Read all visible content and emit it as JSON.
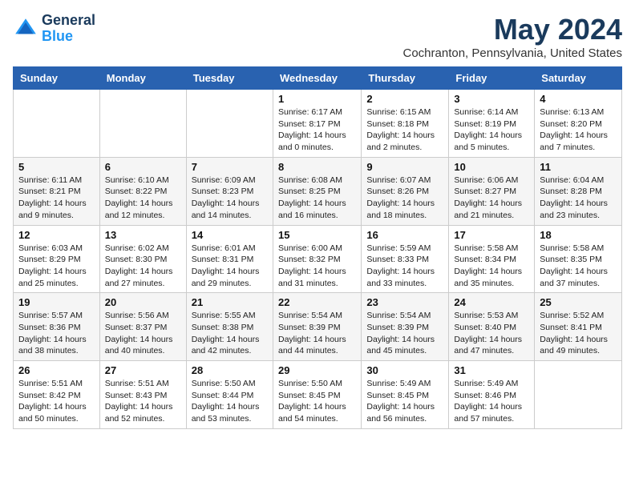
{
  "header": {
    "logo_line1": "General",
    "logo_line2": "Blue",
    "month": "May 2024",
    "location": "Cochranton, Pennsylvania, United States"
  },
  "weekdays": [
    "Sunday",
    "Monday",
    "Tuesday",
    "Wednesday",
    "Thursday",
    "Friday",
    "Saturday"
  ],
  "weeks": [
    [
      null,
      null,
      null,
      {
        "day": 1,
        "sunrise": "6:17 AM",
        "sunset": "8:17 PM",
        "daylight": "14 hours and 0 minutes."
      },
      {
        "day": 2,
        "sunrise": "6:15 AM",
        "sunset": "8:18 PM",
        "daylight": "14 hours and 2 minutes."
      },
      {
        "day": 3,
        "sunrise": "6:14 AM",
        "sunset": "8:19 PM",
        "daylight": "14 hours and 5 minutes."
      },
      {
        "day": 4,
        "sunrise": "6:13 AM",
        "sunset": "8:20 PM",
        "daylight": "14 hours and 7 minutes."
      }
    ],
    [
      {
        "day": 5,
        "sunrise": "6:11 AM",
        "sunset": "8:21 PM",
        "daylight": "14 hours and 9 minutes."
      },
      {
        "day": 6,
        "sunrise": "6:10 AM",
        "sunset": "8:22 PM",
        "daylight": "14 hours and 12 minutes."
      },
      {
        "day": 7,
        "sunrise": "6:09 AM",
        "sunset": "8:23 PM",
        "daylight": "14 hours and 14 minutes."
      },
      {
        "day": 8,
        "sunrise": "6:08 AM",
        "sunset": "8:25 PM",
        "daylight": "14 hours and 16 minutes."
      },
      {
        "day": 9,
        "sunrise": "6:07 AM",
        "sunset": "8:26 PM",
        "daylight": "14 hours and 18 minutes."
      },
      {
        "day": 10,
        "sunrise": "6:06 AM",
        "sunset": "8:27 PM",
        "daylight": "14 hours and 21 minutes."
      },
      {
        "day": 11,
        "sunrise": "6:04 AM",
        "sunset": "8:28 PM",
        "daylight": "14 hours and 23 minutes."
      }
    ],
    [
      {
        "day": 12,
        "sunrise": "6:03 AM",
        "sunset": "8:29 PM",
        "daylight": "14 hours and 25 minutes."
      },
      {
        "day": 13,
        "sunrise": "6:02 AM",
        "sunset": "8:30 PM",
        "daylight": "14 hours and 27 minutes."
      },
      {
        "day": 14,
        "sunrise": "6:01 AM",
        "sunset": "8:31 PM",
        "daylight": "14 hours and 29 minutes."
      },
      {
        "day": 15,
        "sunrise": "6:00 AM",
        "sunset": "8:32 PM",
        "daylight": "14 hours and 31 minutes."
      },
      {
        "day": 16,
        "sunrise": "5:59 AM",
        "sunset": "8:33 PM",
        "daylight": "14 hours and 33 minutes."
      },
      {
        "day": 17,
        "sunrise": "5:58 AM",
        "sunset": "8:34 PM",
        "daylight": "14 hours and 35 minutes."
      },
      {
        "day": 18,
        "sunrise": "5:58 AM",
        "sunset": "8:35 PM",
        "daylight": "14 hours and 37 minutes."
      }
    ],
    [
      {
        "day": 19,
        "sunrise": "5:57 AM",
        "sunset": "8:36 PM",
        "daylight": "14 hours and 38 minutes."
      },
      {
        "day": 20,
        "sunrise": "5:56 AM",
        "sunset": "8:37 PM",
        "daylight": "14 hours and 40 minutes."
      },
      {
        "day": 21,
        "sunrise": "5:55 AM",
        "sunset": "8:38 PM",
        "daylight": "14 hours and 42 minutes."
      },
      {
        "day": 22,
        "sunrise": "5:54 AM",
        "sunset": "8:39 PM",
        "daylight": "14 hours and 44 minutes."
      },
      {
        "day": 23,
        "sunrise": "5:54 AM",
        "sunset": "8:39 PM",
        "daylight": "14 hours and 45 minutes."
      },
      {
        "day": 24,
        "sunrise": "5:53 AM",
        "sunset": "8:40 PM",
        "daylight": "14 hours and 47 minutes."
      },
      {
        "day": 25,
        "sunrise": "5:52 AM",
        "sunset": "8:41 PM",
        "daylight": "14 hours and 49 minutes."
      }
    ],
    [
      {
        "day": 26,
        "sunrise": "5:51 AM",
        "sunset": "8:42 PM",
        "daylight": "14 hours and 50 minutes."
      },
      {
        "day": 27,
        "sunrise": "5:51 AM",
        "sunset": "8:43 PM",
        "daylight": "14 hours and 52 minutes."
      },
      {
        "day": 28,
        "sunrise": "5:50 AM",
        "sunset": "8:44 PM",
        "daylight": "14 hours and 53 minutes."
      },
      {
        "day": 29,
        "sunrise": "5:50 AM",
        "sunset": "8:45 PM",
        "daylight": "14 hours and 54 minutes."
      },
      {
        "day": 30,
        "sunrise": "5:49 AM",
        "sunset": "8:45 PM",
        "daylight": "14 hours and 56 minutes."
      },
      {
        "day": 31,
        "sunrise": "5:49 AM",
        "sunset": "8:46 PM",
        "daylight": "14 hours and 57 minutes."
      },
      null
    ]
  ]
}
